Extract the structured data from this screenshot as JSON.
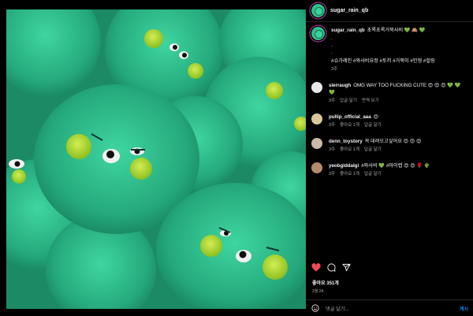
{
  "header": {
    "username": "sugar_rain_qb"
  },
  "caption": {
    "username": "sugar_rain_qb",
    "text": "초록초록거북사비 💚 🙈 💚",
    "dots": ".",
    "hashtags": "#슈가레인 #와사비요정 #토끼 #거북이 #인형 #힐링",
    "time": "3주"
  },
  "comments": [
    {
      "username": "sierraugh",
      "text": "OMG WAY TOO FUCKING CUTE 😍 😍 😍 💚 💚 💚",
      "time": "3주",
      "action1": "답글 달기",
      "action2": "번역 보기",
      "avatar_color": "#e8e8e8"
    },
    {
      "username": "pullip_official_aaa",
      "text": "😍",
      "time": "3주",
      "likes": "좋아요 1개",
      "action1": "답글 달기",
      "avatar_color": "#d9c79a"
    },
    {
      "username": "denn_toystory",
      "text": "꼭 데려오고싶어요 😍 😍 😍",
      "time": "3주",
      "likes": "좋아요 1개",
      "action1": "답글 달기",
      "avatar_color": "#c9b9a6"
    },
    {
      "username": "yeobgiddalgi",
      "text": "#와사비 💚 #마이캡 😍 😍 🌹 🌵",
      "time": "3주",
      "likes": "좋아요 1개",
      "action1": "답글 달기",
      "avatar_color": "#b48a6e"
    }
  ],
  "actions": {
    "like_icon": "heart-icon",
    "comment_icon": "comment-icon",
    "share_icon": "share-icon",
    "heart_color": "#ed4956"
  },
  "likes_text": "좋아요 351개",
  "date_text": "2월 24",
  "add_comment": {
    "placeholder": "댓글 달기...",
    "post_label": "게시"
  },
  "colors": {
    "fur": "#2fbf8c",
    "cheek": "#a8d62a"
  }
}
